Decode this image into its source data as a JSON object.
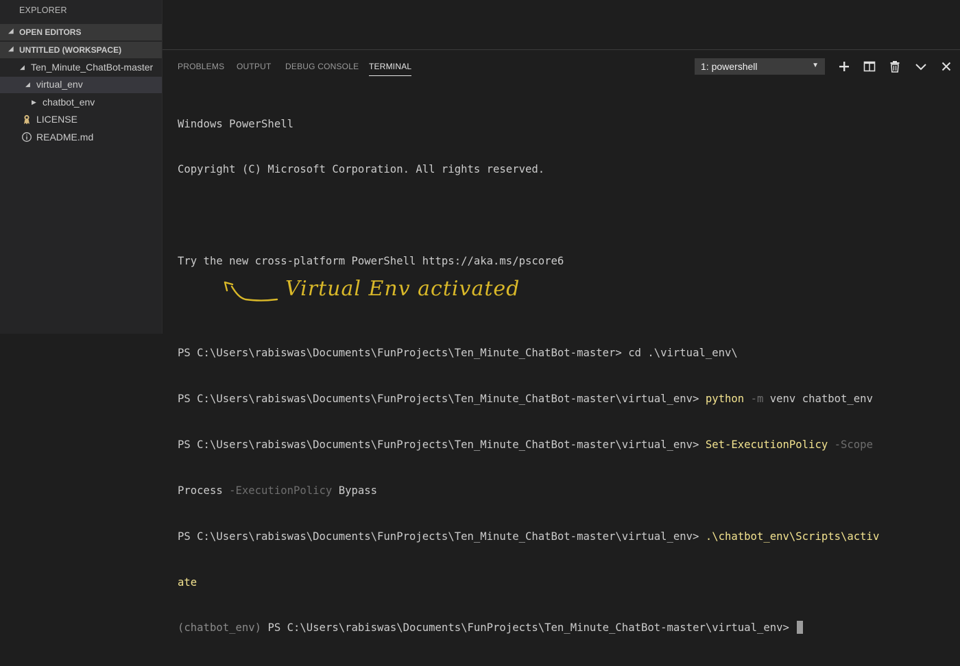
{
  "sidebar": {
    "title": "EXPLORER",
    "sections": [
      {
        "label": "OPEN EDITORS"
      },
      {
        "label": "UNTITLED (WORKSPACE)"
      }
    ],
    "tree": [
      {
        "label": "Ten_Minute_ChatBot-master",
        "icon": "chevron-down-icon"
      },
      {
        "label": "virtual_env",
        "icon": "chevron-down-icon"
      },
      {
        "label": "chatbot_env",
        "icon": "chevron-right-icon"
      },
      {
        "label": "LICENSE",
        "icon": "license-icon"
      },
      {
        "label": "README.md",
        "icon": "info-icon"
      }
    ]
  },
  "panel": {
    "tabs": [
      {
        "label": "PROBLEMS"
      },
      {
        "label": "OUTPUT"
      },
      {
        "label": "DEBUG CONSOLE"
      },
      {
        "label": "TERMINAL",
        "active": true
      }
    ],
    "terminal_select": {
      "value": "1: powershell"
    },
    "toolbar_icons": [
      "plus-icon",
      "split-icon",
      "trash-icon",
      "chevron-down-icon",
      "close-icon"
    ]
  },
  "terminal": {
    "line1": "Windows PowerShell",
    "line2": "Copyright (C) Microsoft Corporation. All rights reserved.",
    "line3": "Try the new cross-platform PowerShell https://aka.ms/pscore6",
    "prompt_master": "PS C:\\Users\\rabiswas\\Documents\\FunProjects\\Ten_Minute_ChatBot-master> ",
    "cmd1": "cd .\\virtual_env\\",
    "prompt_venv": "PS C:\\Users\\rabiswas\\Documents\\FunProjects\\Ten_Minute_ChatBot-master\\virtual_env> ",
    "cmd2_name": "python",
    "cmd2_flag": " -m",
    "cmd2_args": " venv chatbot_env",
    "cmd3_name": "Set-ExecutionPolicy",
    "cmd3_flag1": " -Scope",
    "cmd3_val1": "Process",
    "cmd3_flag2": " -ExecutionPolicy",
    "cmd3_val2": " Bypass",
    "cmd4_part1": ".\\chatbot_env\\Scripts\\activ",
    "cmd4_part2": "ate",
    "env_prefix": "(chatbot_env)",
    "final_prompt": " PS C:\\Users\\rabiswas\\Documents\\FunProjects\\Ten_Minute_ChatBot-master\\virtual_env> "
  },
  "annotation": {
    "text": "Virtual Env activated",
    "color": "#d9b829"
  },
  "colors": {
    "sidebar_bg": "#252526",
    "terminal_bg": "#1e1e1e",
    "command": "#f3e38f",
    "parameter": "#6e6e6e"
  }
}
